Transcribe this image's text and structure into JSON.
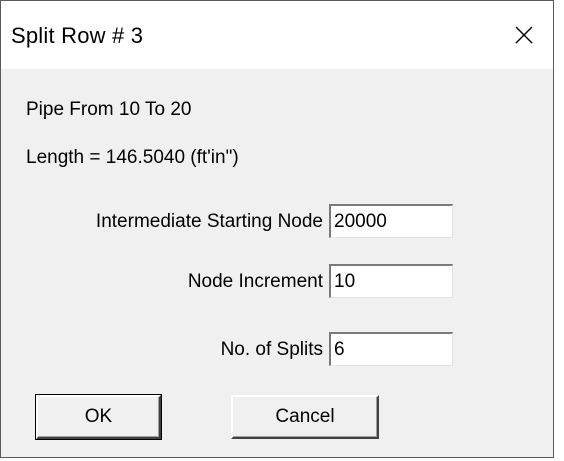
{
  "window": {
    "title": "Split Row  #  3",
    "close_icon": "close-icon"
  },
  "info": {
    "pipe_text": "Pipe  From  10  To  20",
    "length_text": "Length = 146.5040  (ft'in\")"
  },
  "fields": [
    {
      "label": "Intermediate Starting Node",
      "value": "20000"
    },
    {
      "label": "Node Increment",
      "value": "10"
    },
    {
      "label": "No.  of Splits",
      "value": "6"
    }
  ],
  "buttons": {
    "ok_label": "OK",
    "cancel_label": "Cancel"
  }
}
